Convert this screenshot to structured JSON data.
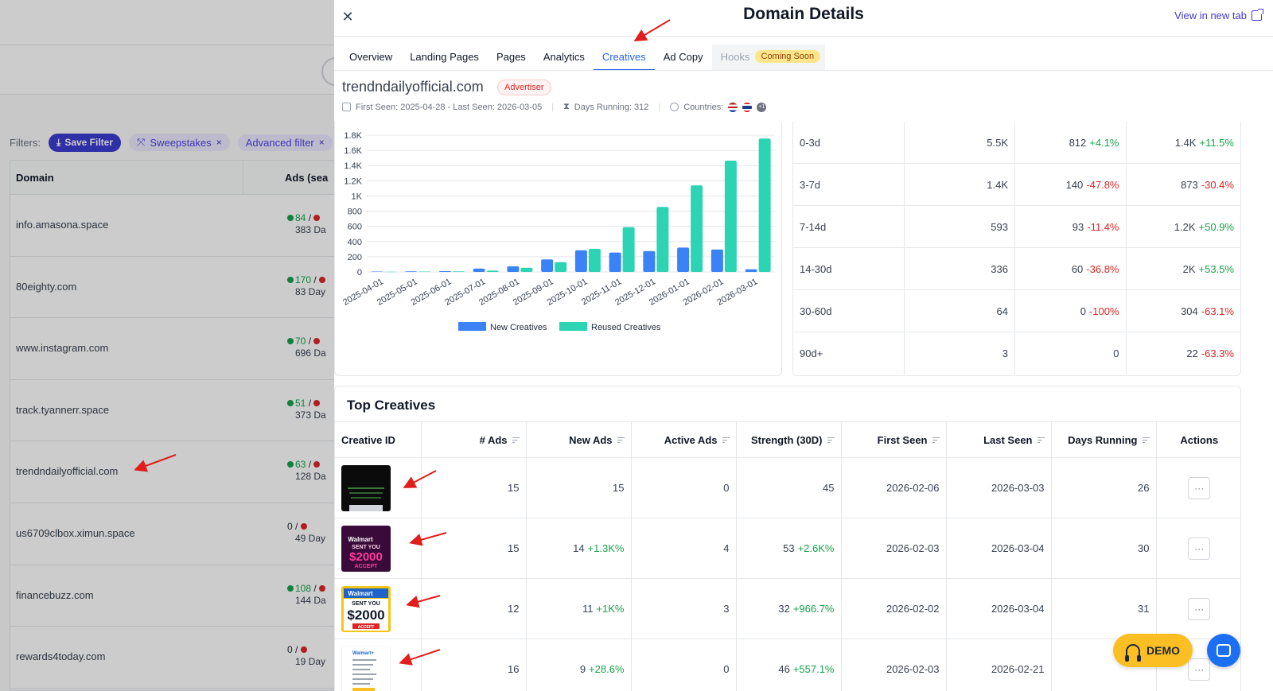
{
  "background": {
    "filters_label": "Filters:",
    "save_filter_label": "Save Filter",
    "chips": [
      {
        "label": "Sweepstakes",
        "close": "×"
      },
      {
        "label": "Advanced filter",
        "close": "×"
      }
    ],
    "table_headers": {
      "domain": "Domain",
      "ads": "Ads (sea"
    },
    "rows": [
      {
        "domain": "info.amasona.space",
        "active": "84",
        "sep": " / ",
        "days": "383 Da",
        "has_active": true
      },
      {
        "domain": "80eighty.com",
        "active": "170",
        "sep": " / ",
        "days": "83 Day",
        "has_active": true
      },
      {
        "domain": "www.instagram.com",
        "active": "70",
        "sep": " / ",
        "days": "696 Da",
        "has_active": true
      },
      {
        "domain": "track.tyannerr.space",
        "active": "51",
        "sep": " / ",
        "days": "373 Da",
        "has_active": true
      },
      {
        "domain": "trendndailyofficial.com",
        "active": "63",
        "sep": " / ",
        "days": "128 Da",
        "has_active": true
      },
      {
        "domain": "us6709clbox.ximun.space",
        "active": "0",
        "sep": " / ",
        "days": "49 Day",
        "has_active": false
      },
      {
        "domain": "financebuzz.com",
        "active": "108",
        "sep": " / ",
        "days": "144 Da",
        "has_active": true
      },
      {
        "domain": "rewards4today.com",
        "active": "0",
        "sep": " / ",
        "days": "19 Day",
        "has_active": false
      }
    ]
  },
  "panel": {
    "title": "Domain Details",
    "view_new_tab": "View in new tab",
    "tabs": [
      {
        "label": "Overview",
        "state": "normal"
      },
      {
        "label": "Landing Pages",
        "state": "normal"
      },
      {
        "label": "Pages",
        "state": "normal"
      },
      {
        "label": "Analytics",
        "state": "normal"
      },
      {
        "label": "Creatives",
        "state": "active"
      },
      {
        "label": "Ad Copy",
        "state": "normal"
      }
    ],
    "hooks_tab": {
      "label": "Hooks",
      "badge": "Coming Soon"
    },
    "domain": "trendndailyofficial.com",
    "domain_badge": "Advertiser",
    "first_last_seen": "First Seen: 2025-04-28 - Last Seen: 2026-03-05",
    "days_running": "Days Running: 312",
    "countries_label": "Countries:",
    "countries_more": "+1"
  },
  "chart_data": {
    "type": "bar",
    "categories": [
      "2025-04-01",
      "2025-05-01",
      "2025-06-01",
      "2025-07-01",
      "2025-08-01",
      "2025-09-01",
      "2025-10-01",
      "2025-11-01",
      "2025-12-01",
      "2026-01-01",
      "2026-02-01",
      "2026-03-01"
    ],
    "series": [
      {
        "name": "New Creatives",
        "values": [
          5,
          8,
          10,
          45,
          75,
          165,
          285,
          255,
          275,
          320,
          295,
          35
        ]
      },
      {
        "name": "Reused Creatives",
        "values": [
          3,
          5,
          8,
          18,
          55,
          130,
          305,
          590,
          855,
          1140,
          1465,
          1755
        ]
      }
    ],
    "y_ticks": [
      "0",
      "200",
      "400",
      "600",
      "800",
      "1K",
      "1.2K",
      "1.4K",
      "1.6K",
      "1.8K"
    ],
    "ylim": [
      0,
      1800
    ],
    "colors": {
      "New Creatives": "#3b82f6",
      "Reused Creatives": "#2dd4b3"
    },
    "grid": true,
    "legend": "bottom"
  },
  "retention": [
    {
      "range": "0-3d",
      "total": "5.5K",
      "mid": "812",
      "mid_change": "+4.1%",
      "mid_dir": "pos",
      "last": "1.4K",
      "last_change": "+11.5%",
      "last_dir": "pos"
    },
    {
      "range": "3-7d",
      "total": "1.4K",
      "mid": "140",
      "mid_change": "-47.8%",
      "mid_dir": "neg",
      "last": "873",
      "last_change": "-30.4%",
      "last_dir": "neg"
    },
    {
      "range": "7-14d",
      "total": "593",
      "mid": "93",
      "mid_change": "-11.4%",
      "mid_dir": "neg",
      "last": "1.2K",
      "last_change": "+50.9%",
      "last_dir": "pos"
    },
    {
      "range": "14-30d",
      "total": "336",
      "mid": "60",
      "mid_change": "-36.8%",
      "mid_dir": "neg",
      "last": "2K",
      "last_change": "+53.5%",
      "last_dir": "pos"
    },
    {
      "range": "30-60d",
      "total": "64",
      "mid": "0",
      "mid_change": "-100%",
      "mid_dir": "neg",
      "last": "304",
      "last_change": "-63.1%",
      "last_dir": "neg"
    },
    {
      "range": "90d+",
      "total": "3",
      "mid": "0",
      "mid_change": "",
      "mid_dir": "pos",
      "last": "22",
      "last_change": "-63.3%",
      "last_dir": "neg"
    }
  ],
  "top_creatives": {
    "title": "Top Creatives",
    "headers": [
      "Creative ID",
      "# Ads",
      "New Ads",
      "Active Ads",
      "Strength (30D)",
      "First Seen",
      "Last Seen",
      "Days Running",
      "Actions"
    ],
    "rows": [
      {
        "thumb": "dark-app",
        "ads": "15",
        "new": "15",
        "new_change": "",
        "active": "0",
        "strength": "45",
        "strength_change": "",
        "first": "2026-02-06",
        "last": "2026-03-03",
        "days": "26"
      },
      {
        "thumb": "walmart-neon",
        "thumb_text": [
          "Walmart",
          "SENT YOU",
          "$2000",
          "ACCEPT"
        ],
        "ads": "15",
        "new": "14",
        "new_change": "+1.3K%",
        "active": "4",
        "strength": "53",
        "strength_change": "+2.6K%",
        "first": "2026-02-03",
        "last": "2026-03-04",
        "days": "30"
      },
      {
        "thumb": "walmart-yellow",
        "thumb_text": [
          "Walmart",
          "SENT YOU",
          "$2000",
          "ACCEPT"
        ],
        "ads": "12",
        "new": "11",
        "new_change": "+1K%",
        "active": "3",
        "strength": "32",
        "strength_change": "+966.7%",
        "first": "2026-02-02",
        "last": "2026-03-04",
        "days": "31"
      },
      {
        "thumb": "walmart-letter",
        "thumb_text": [
          "Walmart+"
        ],
        "ads": "16",
        "new": "9",
        "new_change": "+28.6%",
        "active": "0",
        "strength": "46",
        "strength_change": "+557.1%",
        "first": "2026-02-03",
        "last": "2026-02-21",
        "days": ""
      }
    ],
    "action_label": "···"
  },
  "floating": {
    "demo_label": "DEMO"
  },
  "icons": {
    "close": "close-icon",
    "external": "external-link-icon",
    "calendar": "calendar-icon",
    "hourglass": "hourglass-icon",
    "globe": "globe-icon",
    "download": "download-icon",
    "headset": "headset-icon",
    "chat": "chat-icon",
    "sort": "sort-icon"
  }
}
